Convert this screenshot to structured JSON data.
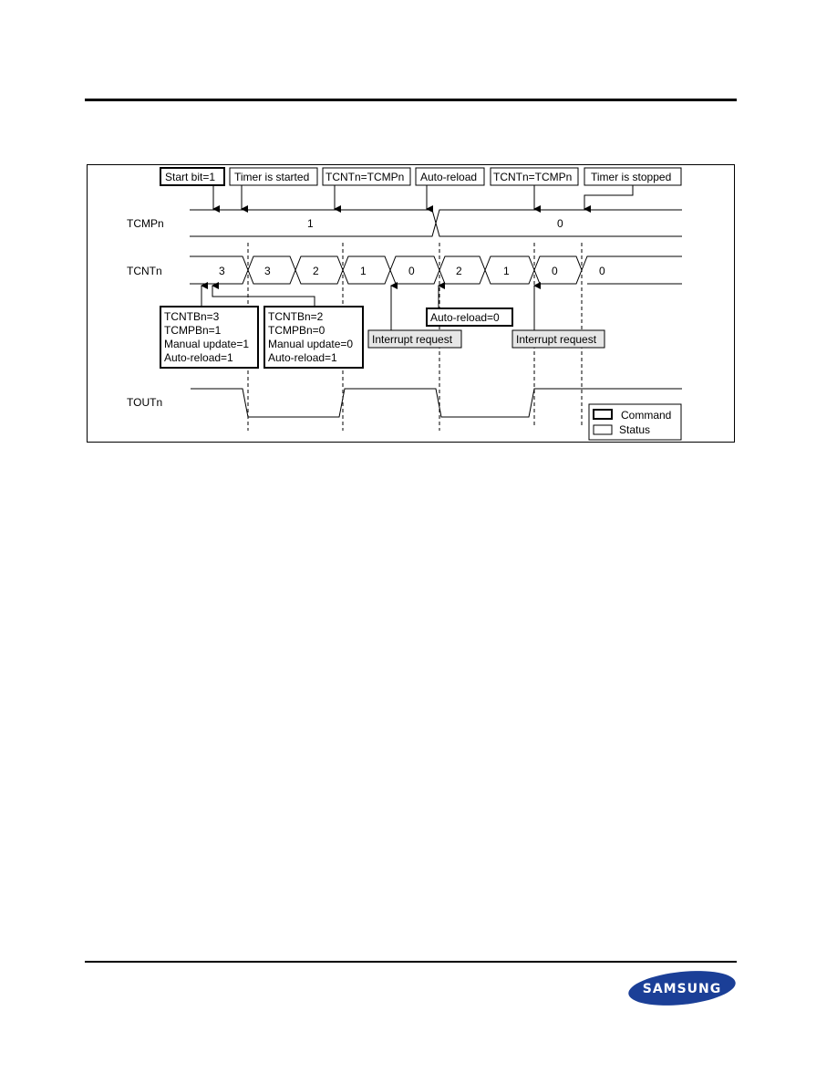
{
  "diagram": {
    "signals": {
      "tcmp": "TCMPn",
      "tcnt": "TCNTn",
      "tout": "TOUTn"
    },
    "top_labels": [
      {
        "text": "Start bit=1",
        "kind": "command"
      },
      {
        "text": "Timer is started",
        "kind": "status"
      },
      {
        "text": "TCNTn=TCMPn",
        "kind": "status"
      },
      {
        "text": "Auto-reload",
        "kind": "status"
      },
      {
        "text": "TCNTn=TCMPn",
        "kind": "status"
      },
      {
        "text": "Timer is stopped",
        "kind": "status"
      }
    ],
    "tcmp_values": [
      "1",
      "0"
    ],
    "tcnt_values": [
      "3",
      "3",
      "2",
      "1",
      "0",
      "2",
      "1",
      "0",
      "0"
    ],
    "command_box_1": [
      "TCNTBn=3",
      "TCMPBn=1",
      "Manual update=1",
      "Auto-reload=1"
    ],
    "command_box_2": [
      "TCNTBn=2",
      "TCMPBn=0",
      "Manual update=0",
      "Auto-reload=1"
    ],
    "auto_reload_box": "Auto-reload=0",
    "interrupt_labels": [
      "Interrupt request",
      "Interrupt request"
    ],
    "legend": {
      "command": "Command",
      "status": "Status"
    }
  },
  "footer": {
    "logo_text": "SAMSUNG",
    "logo_color": "#1b3f97"
  }
}
